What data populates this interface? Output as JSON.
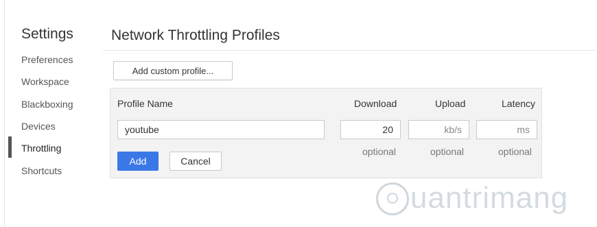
{
  "sidebar": {
    "title": "Settings",
    "items": [
      {
        "label": "Preferences"
      },
      {
        "label": "Workspace"
      },
      {
        "label": "Blackboxing"
      },
      {
        "label": "Devices"
      },
      {
        "label": "Throttling",
        "active": true
      },
      {
        "label": "Shortcuts"
      }
    ]
  },
  "main": {
    "title": "Network Throttling Profiles",
    "add_custom_label": "Add custom profile..."
  },
  "form": {
    "profile_name_header": "Profile Name",
    "download_header": "Download",
    "upload_header": "Upload",
    "latency_header": "Latency",
    "profile_name_value": "youtube",
    "download_value": "20",
    "upload_placeholder": "kb/s",
    "latency_placeholder": "ms",
    "optional_label": "optional",
    "add_label": "Add",
    "cancel_label": "Cancel"
  },
  "watermark": {
    "text": "uantrimang"
  },
  "colors": {
    "accent": "#3b78e7",
    "panel_bg": "#f3f3f3"
  }
}
